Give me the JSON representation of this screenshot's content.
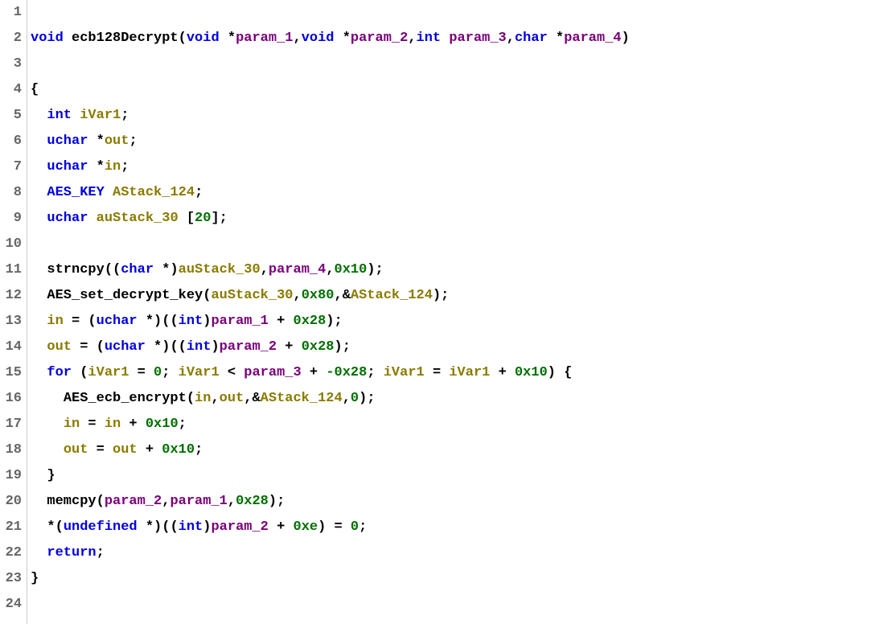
{
  "editor": {
    "lines": [
      {
        "n": "1",
        "tokens": []
      },
      {
        "n": "2",
        "tokens": [
          {
            "t": "void ",
            "c": "kw"
          },
          {
            "t": "ecb128Decrypt",
            "c": "fn"
          },
          {
            "t": "(",
            "c": "br"
          },
          {
            "t": "void ",
            "c": "kw"
          },
          {
            "t": "*",
            "c": "op"
          },
          {
            "t": "param_1",
            "c": "pr"
          },
          {
            "t": ",",
            "c": "pn"
          },
          {
            "t": "void ",
            "c": "kw"
          },
          {
            "t": "*",
            "c": "op"
          },
          {
            "t": "param_2",
            "c": "pr"
          },
          {
            "t": ",",
            "c": "pn"
          },
          {
            "t": "int ",
            "c": "kw"
          },
          {
            "t": "param_3",
            "c": "pr"
          },
          {
            "t": ",",
            "c": "pn"
          },
          {
            "t": "char ",
            "c": "kw"
          },
          {
            "t": "*",
            "c": "op"
          },
          {
            "t": "param_4",
            "c": "pr"
          },
          {
            "t": ")",
            "c": "br"
          }
        ]
      },
      {
        "n": "3",
        "tokens": []
      },
      {
        "n": "4",
        "tokens": [
          {
            "t": "{",
            "c": "br"
          }
        ]
      },
      {
        "n": "5",
        "tokens": [
          {
            "t": "  ",
            "c": "sp"
          },
          {
            "t": "int ",
            "c": "kw"
          },
          {
            "t": "iVar1",
            "c": "lv"
          },
          {
            "t": ";",
            "c": "pn"
          }
        ]
      },
      {
        "n": "6",
        "tokens": [
          {
            "t": "  ",
            "c": "sp"
          },
          {
            "t": "uchar ",
            "c": "ty"
          },
          {
            "t": "*",
            "c": "op"
          },
          {
            "t": "out",
            "c": "lv"
          },
          {
            "t": ";",
            "c": "pn"
          }
        ]
      },
      {
        "n": "7",
        "tokens": [
          {
            "t": "  ",
            "c": "sp"
          },
          {
            "t": "uchar ",
            "c": "ty"
          },
          {
            "t": "*",
            "c": "op"
          },
          {
            "t": "in",
            "c": "lv"
          },
          {
            "t": ";",
            "c": "pn"
          }
        ]
      },
      {
        "n": "8",
        "tokens": [
          {
            "t": "  ",
            "c": "sp"
          },
          {
            "t": "AES_KEY ",
            "c": "ty"
          },
          {
            "t": "AStack_124",
            "c": "lv"
          },
          {
            "t": ";",
            "c": "pn"
          }
        ]
      },
      {
        "n": "9",
        "tokens": [
          {
            "t": "  ",
            "c": "sp"
          },
          {
            "t": "uchar ",
            "c": "ty"
          },
          {
            "t": "auStack_30 ",
            "c": "lv"
          },
          {
            "t": "[",
            "c": "br"
          },
          {
            "t": "20",
            "c": "nm"
          },
          {
            "t": "]",
            "c": "br"
          },
          {
            "t": ";",
            "c": "pn"
          }
        ]
      },
      {
        "n": "10",
        "tokens": [
          {
            "t": "  ",
            "c": "sp"
          }
        ]
      },
      {
        "n": "11",
        "tokens": [
          {
            "t": "  ",
            "c": "sp"
          },
          {
            "t": "strncpy",
            "c": "fn"
          },
          {
            "t": "((",
            "c": "br"
          },
          {
            "t": "char ",
            "c": "kw"
          },
          {
            "t": "*",
            "c": "op"
          },
          {
            "t": ")",
            "c": "br"
          },
          {
            "t": "auStack_30",
            "c": "lv"
          },
          {
            "t": ",",
            "c": "pn"
          },
          {
            "t": "param_4",
            "c": "pr"
          },
          {
            "t": ",",
            "c": "pn"
          },
          {
            "t": "0x10",
            "c": "nm"
          },
          {
            "t": ")",
            "c": "br"
          },
          {
            "t": ";",
            "c": "pn"
          }
        ]
      },
      {
        "n": "12",
        "tokens": [
          {
            "t": "  ",
            "c": "sp"
          },
          {
            "t": "AES_set_decrypt_key",
            "c": "fn"
          },
          {
            "t": "(",
            "c": "br"
          },
          {
            "t": "auStack_30",
            "c": "lv"
          },
          {
            "t": ",",
            "c": "pn"
          },
          {
            "t": "0x80",
            "c": "nm"
          },
          {
            "t": ",",
            "c": "pn"
          },
          {
            "t": "&",
            "c": "op"
          },
          {
            "t": "AStack_124",
            "c": "lv"
          },
          {
            "t": ")",
            "c": "br"
          },
          {
            "t": ";",
            "c": "pn"
          }
        ]
      },
      {
        "n": "13",
        "tokens": [
          {
            "t": "  ",
            "c": "sp"
          },
          {
            "t": "in",
            "c": "lv"
          },
          {
            "t": " = ",
            "c": "op"
          },
          {
            "t": "(",
            "c": "br"
          },
          {
            "t": "uchar ",
            "c": "ty"
          },
          {
            "t": "*",
            "c": "op"
          },
          {
            "t": ")((",
            "c": "br"
          },
          {
            "t": "int",
            "c": "kw"
          },
          {
            "t": ")",
            "c": "br"
          },
          {
            "t": "param_1",
            "c": "pr"
          },
          {
            "t": " + ",
            "c": "op"
          },
          {
            "t": "0x28",
            "c": "nm"
          },
          {
            "t": ")",
            "c": "br"
          },
          {
            "t": ";",
            "c": "pn"
          }
        ]
      },
      {
        "n": "14",
        "tokens": [
          {
            "t": "  ",
            "c": "sp"
          },
          {
            "t": "out",
            "c": "lv"
          },
          {
            "t": " = ",
            "c": "op"
          },
          {
            "t": "(",
            "c": "br"
          },
          {
            "t": "uchar ",
            "c": "ty"
          },
          {
            "t": "*",
            "c": "op"
          },
          {
            "t": ")((",
            "c": "br"
          },
          {
            "t": "int",
            "c": "kw"
          },
          {
            "t": ")",
            "c": "br"
          },
          {
            "t": "param_2",
            "c": "pr"
          },
          {
            "t": " + ",
            "c": "op"
          },
          {
            "t": "0x28",
            "c": "nm"
          },
          {
            "t": ")",
            "c": "br"
          },
          {
            "t": ";",
            "c": "pn"
          }
        ]
      },
      {
        "n": "15",
        "tokens": [
          {
            "t": "  ",
            "c": "sp"
          },
          {
            "t": "for ",
            "c": "kw"
          },
          {
            "t": "(",
            "c": "br"
          },
          {
            "t": "iVar1",
            "c": "lv"
          },
          {
            "t": " = ",
            "c": "op"
          },
          {
            "t": "0",
            "c": "nm"
          },
          {
            "t": "; ",
            "c": "pn"
          },
          {
            "t": "iVar1",
            "c": "lv"
          },
          {
            "t": " < ",
            "c": "op"
          },
          {
            "t": "param_3",
            "c": "pr"
          },
          {
            "t": " + ",
            "c": "op"
          },
          {
            "t": "-0x28",
            "c": "nm"
          },
          {
            "t": "; ",
            "c": "pn"
          },
          {
            "t": "iVar1",
            "c": "lv"
          },
          {
            "t": " = ",
            "c": "op"
          },
          {
            "t": "iVar1",
            "c": "lv"
          },
          {
            "t": " + ",
            "c": "op"
          },
          {
            "t": "0x10",
            "c": "nm"
          },
          {
            "t": ") {",
            "c": "br"
          }
        ]
      },
      {
        "n": "16",
        "tokens": [
          {
            "t": "    ",
            "c": "sp"
          },
          {
            "t": "AES_ecb_encrypt",
            "c": "fn"
          },
          {
            "t": "(",
            "c": "br"
          },
          {
            "t": "in",
            "c": "lv"
          },
          {
            "t": ",",
            "c": "pn"
          },
          {
            "t": "out",
            "c": "lv"
          },
          {
            "t": ",",
            "c": "pn"
          },
          {
            "t": "&",
            "c": "op"
          },
          {
            "t": "AStack_124",
            "c": "lv"
          },
          {
            "t": ",",
            "c": "pn"
          },
          {
            "t": "0",
            "c": "nm"
          },
          {
            "t": ")",
            "c": "br"
          },
          {
            "t": ";",
            "c": "pn"
          }
        ]
      },
      {
        "n": "17",
        "tokens": [
          {
            "t": "    ",
            "c": "sp"
          },
          {
            "t": "in",
            "c": "lv"
          },
          {
            "t": " = ",
            "c": "op"
          },
          {
            "t": "in",
            "c": "lv"
          },
          {
            "t": " + ",
            "c": "op"
          },
          {
            "t": "0x10",
            "c": "nm"
          },
          {
            "t": ";",
            "c": "pn"
          }
        ]
      },
      {
        "n": "18",
        "tokens": [
          {
            "t": "    ",
            "c": "sp"
          },
          {
            "t": "out",
            "c": "lv"
          },
          {
            "t": " = ",
            "c": "op"
          },
          {
            "t": "out",
            "c": "lv"
          },
          {
            "t": " + ",
            "c": "op"
          },
          {
            "t": "0x10",
            "c": "nm"
          },
          {
            "t": ";",
            "c": "pn"
          }
        ]
      },
      {
        "n": "19",
        "tokens": [
          {
            "t": "  ",
            "c": "sp"
          },
          {
            "t": "}",
            "c": "br"
          }
        ]
      },
      {
        "n": "20",
        "tokens": [
          {
            "t": "  ",
            "c": "sp"
          },
          {
            "t": "memcpy",
            "c": "fn"
          },
          {
            "t": "(",
            "c": "br"
          },
          {
            "t": "param_2",
            "c": "pr"
          },
          {
            "t": ",",
            "c": "pn"
          },
          {
            "t": "param_1",
            "c": "pr"
          },
          {
            "t": ",",
            "c": "pn"
          },
          {
            "t": "0x28",
            "c": "nm"
          },
          {
            "t": ")",
            "c": "br"
          },
          {
            "t": ";",
            "c": "pn"
          }
        ]
      },
      {
        "n": "21",
        "tokens": [
          {
            "t": "  ",
            "c": "sp"
          },
          {
            "t": "*",
            "c": "op"
          },
          {
            "t": "(",
            "c": "br"
          },
          {
            "t": "undefined ",
            "c": "ty"
          },
          {
            "t": "*",
            "c": "op"
          },
          {
            "t": ")((",
            "c": "br"
          },
          {
            "t": "int",
            "c": "kw"
          },
          {
            "t": ")",
            "c": "br"
          },
          {
            "t": "param_2",
            "c": "pr"
          },
          {
            "t": " + ",
            "c": "op"
          },
          {
            "t": "0xe",
            "c": "nm"
          },
          {
            "t": ") = ",
            "c": "br"
          },
          {
            "t": "0",
            "c": "nm"
          },
          {
            "t": ";",
            "c": "pn"
          }
        ]
      },
      {
        "n": "22",
        "tokens": [
          {
            "t": "  ",
            "c": "sp"
          },
          {
            "t": "return",
            "c": "kw"
          },
          {
            "t": ";",
            "c": "pn"
          }
        ]
      },
      {
        "n": "23",
        "tokens": [
          {
            "t": "}",
            "c": "br"
          }
        ]
      },
      {
        "n": "24",
        "tokens": []
      }
    ]
  }
}
